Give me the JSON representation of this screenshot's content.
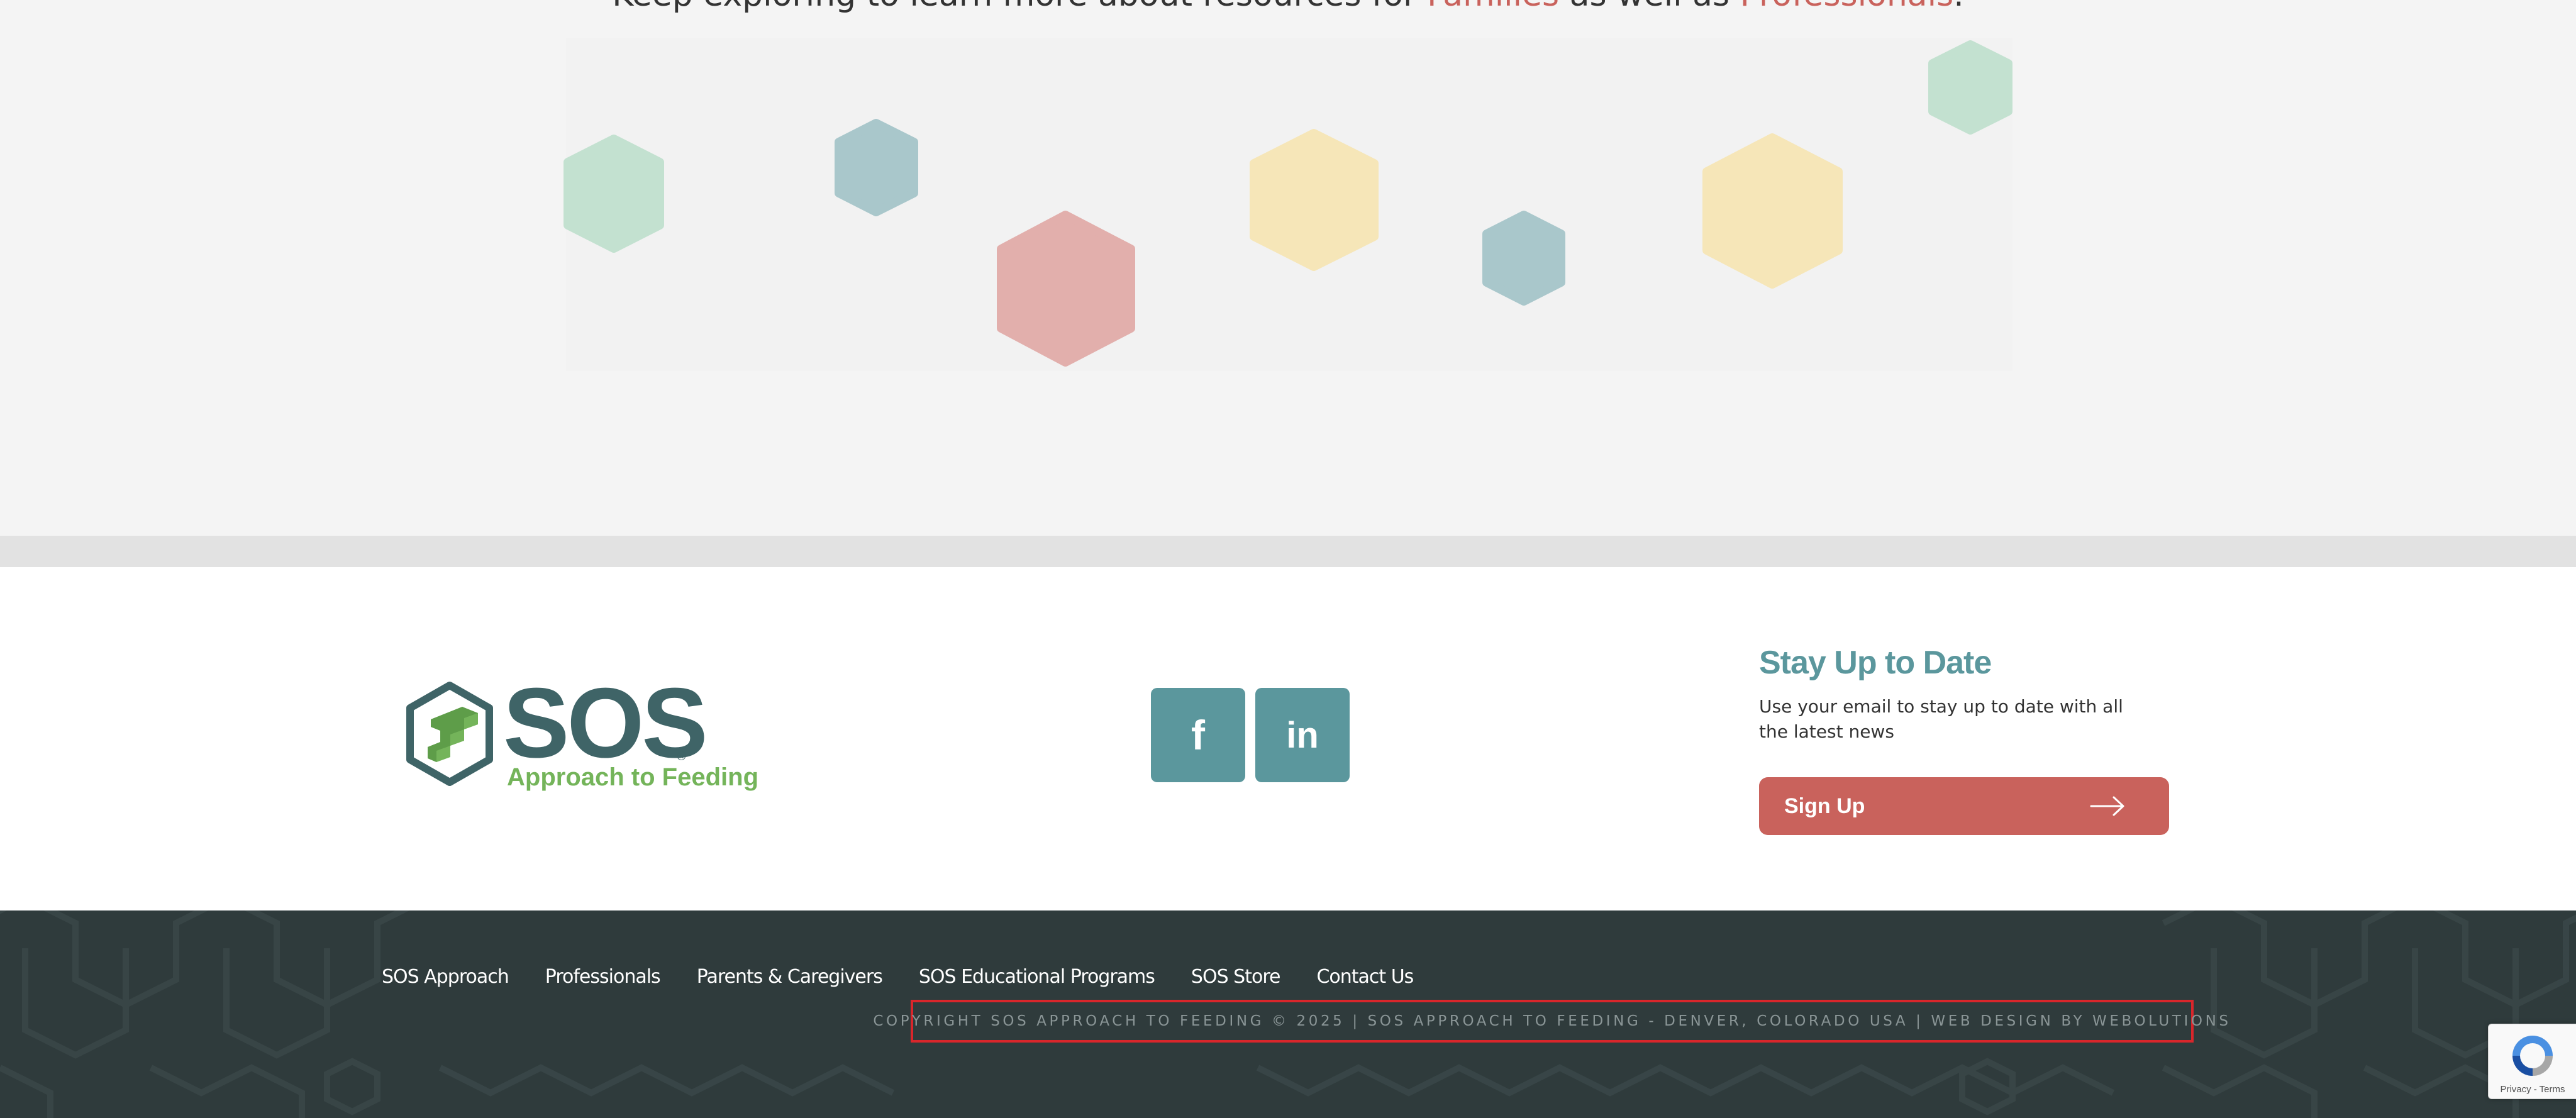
{
  "explore": {
    "heading_prefix": "Keep exploring to learn more about resources for ",
    "link_families": "Families",
    "heading_middle": " as well as ",
    "link_professionals": "Professionals",
    "heading_suffix": "."
  },
  "logo": {
    "wordmark": "SOS",
    "registered": "®",
    "tagline": "Approach to Feeding"
  },
  "social": {
    "facebook_glyph": "f",
    "linkedin_glyph": "in"
  },
  "newsletter": {
    "title": "Stay Up to Date",
    "description": "Use your email to stay up to date with all the latest news",
    "button_label": "Sign Up"
  },
  "footer_nav": {
    "items": [
      "SOS Approach",
      "Professionals",
      "Parents & Caregivers",
      "SOS Educational Programs",
      "SOS Store",
      "Contact Us"
    ]
  },
  "copyright": "COPYRIGHT SOS APPROACH TO FEEDING © 2025 | SOS APPROACH TO FEEDING - DENVER, COLORADO USA | WEB DESIGN BY WEBOLUTIONS",
  "recaptcha": {
    "terms": "Privacy - Terms"
  },
  "colors": {
    "accent_red": "#c9625c",
    "teal": "#5b979d",
    "logo_green": "#74b45a",
    "footer_dark": "#2f3b3c"
  }
}
